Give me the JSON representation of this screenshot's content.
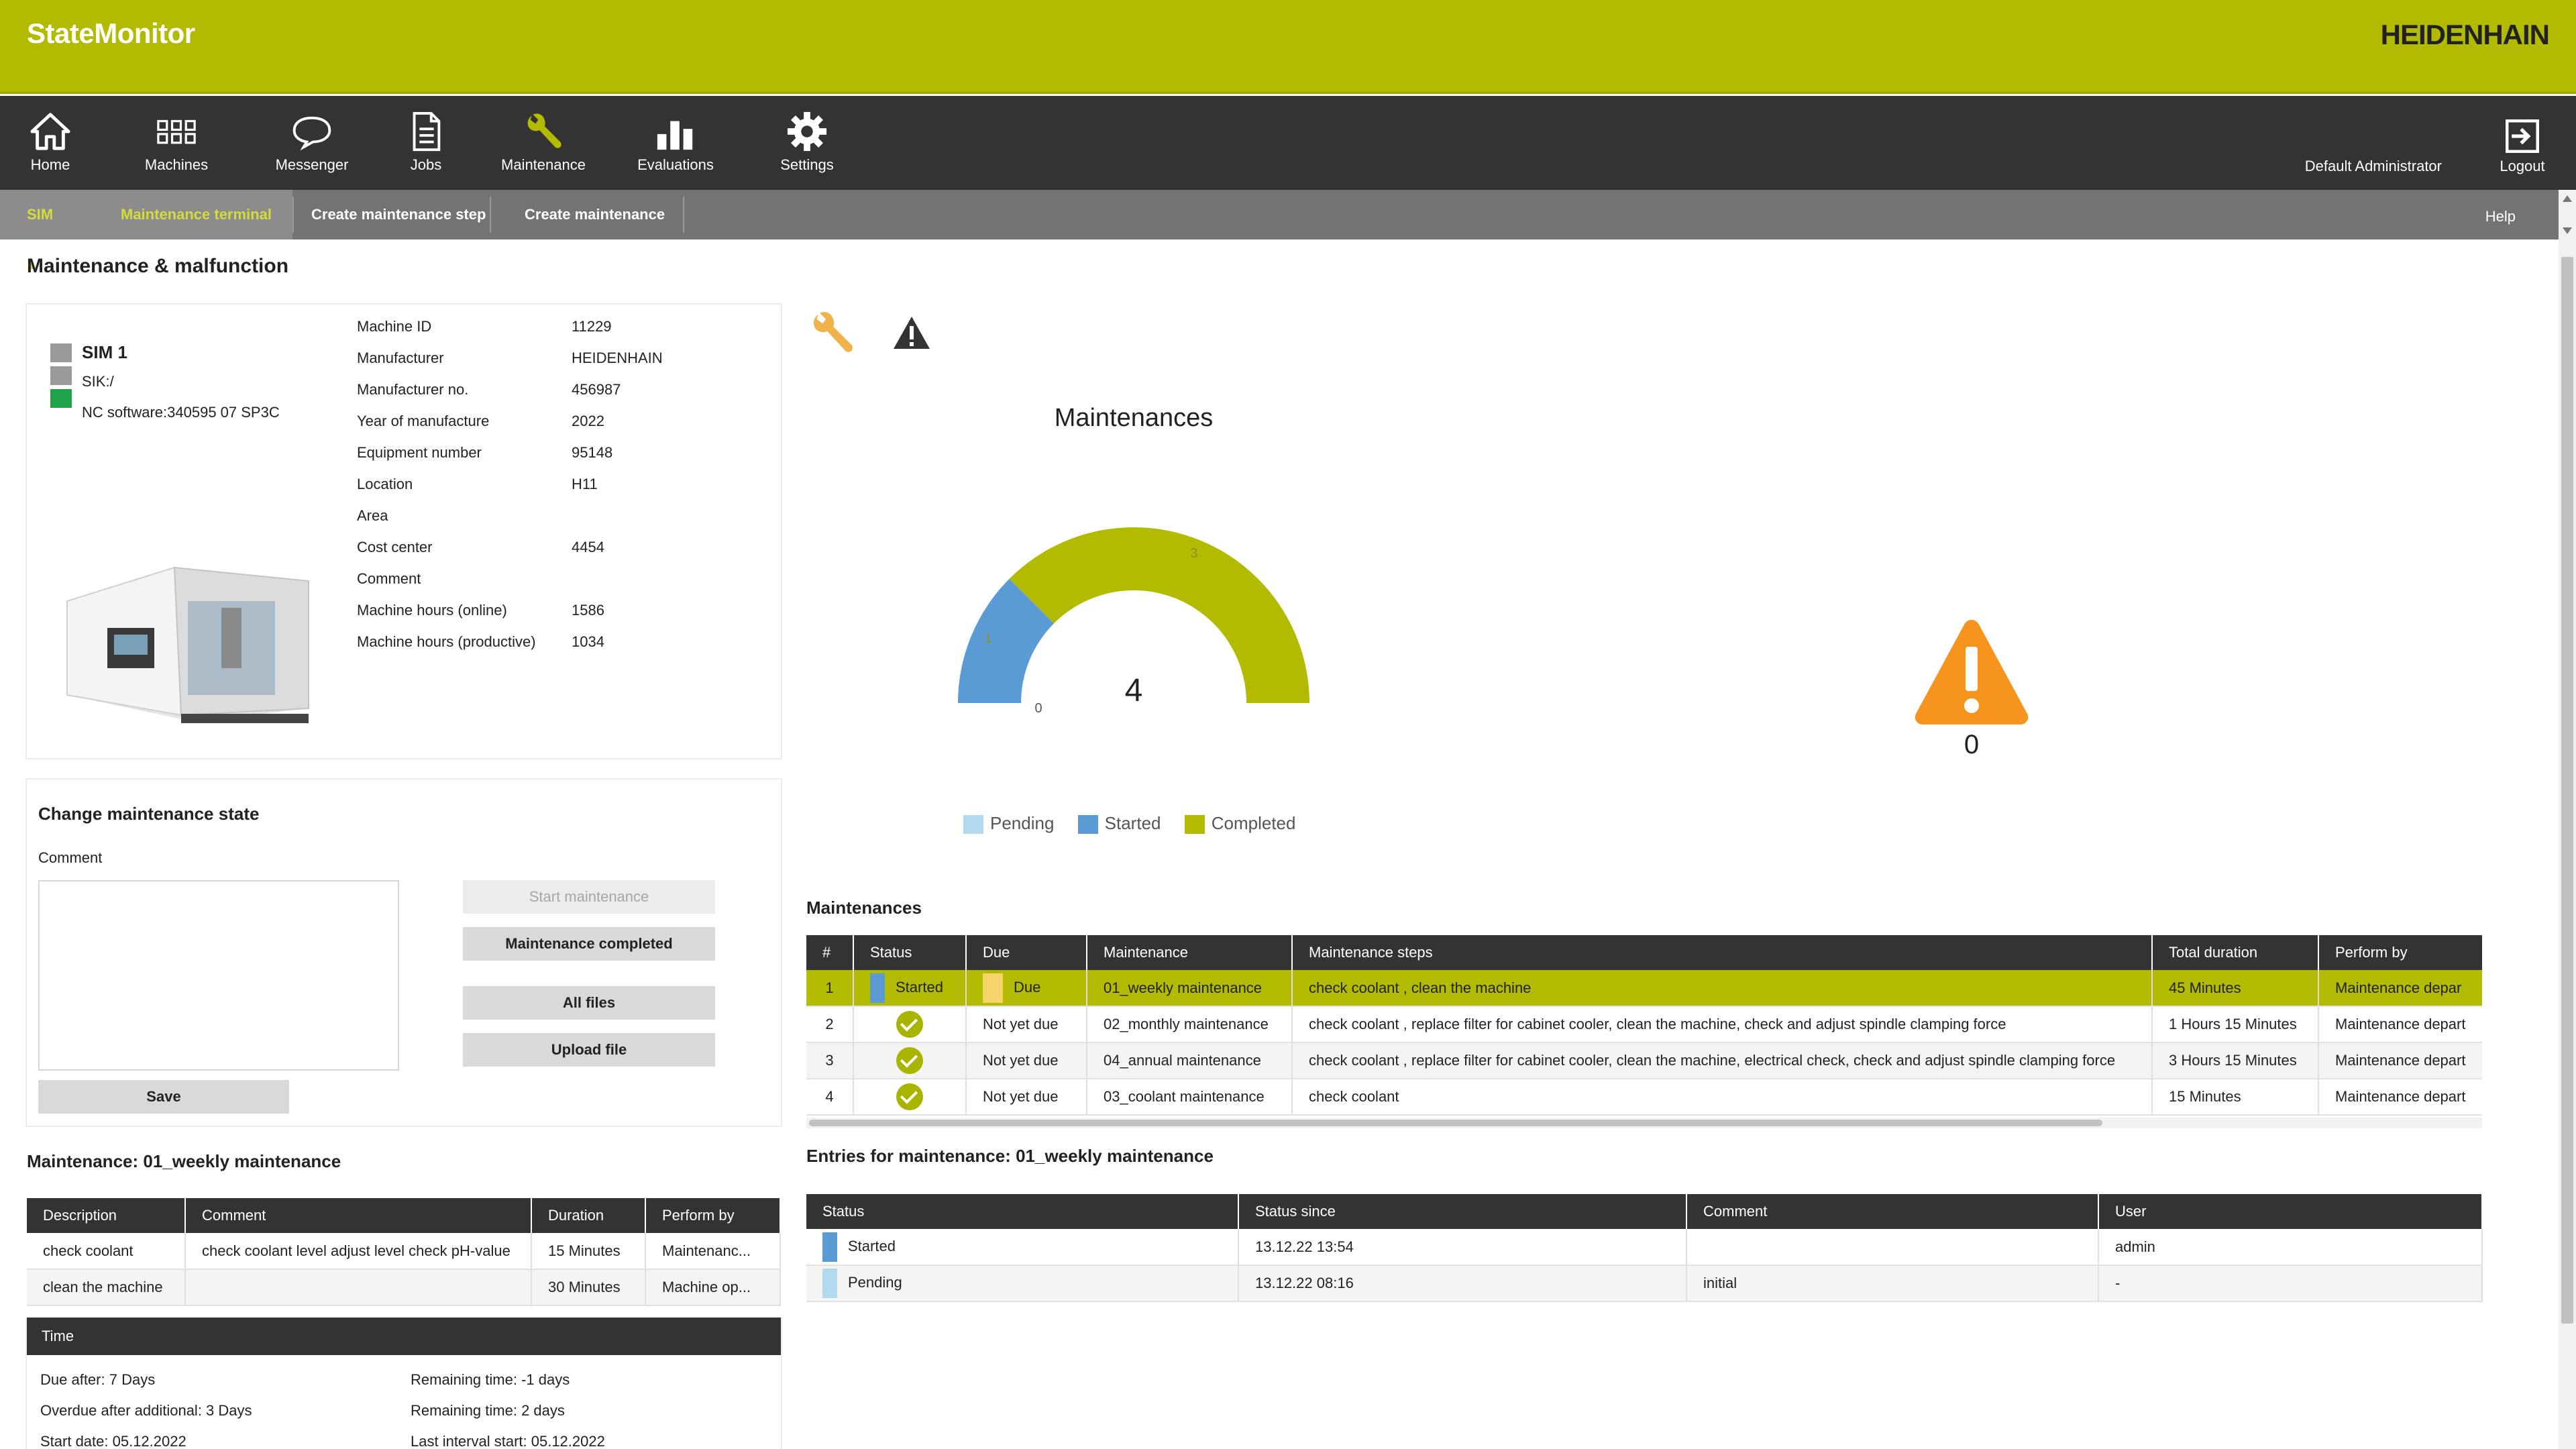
{
  "header": {
    "app_title": "StateMonitor",
    "brand": "HEIDENHAIN",
    "accent_color": "#b2bb00"
  },
  "nav": {
    "items": [
      {
        "label": "Home",
        "icon": "home-icon"
      },
      {
        "label": "Machines",
        "icon": "machines-grid-icon"
      },
      {
        "label": "Messenger",
        "icon": "speech-bubble-icon"
      },
      {
        "label": "Jobs",
        "icon": "document-icon"
      },
      {
        "label": "Maintenance",
        "icon": "wrench-icon"
      },
      {
        "label": "Evaluations",
        "icon": "bar-chart-icon"
      },
      {
        "label": "Settings",
        "icon": "gear-icon"
      }
    ],
    "user": "Default Administrator",
    "logout_label": "Logout"
  },
  "subnav": {
    "machine": "SIM 1",
    "items": [
      "Maintenance terminal",
      "Create maintenance step",
      "Create maintenance"
    ],
    "help": "Help"
  },
  "page": {
    "title": "Maintenance & malfunction"
  },
  "machine": {
    "name": "SIM 1",
    "sik": "SIK:/",
    "nc_software": "NC software:340595 07 SP3C",
    "status_colors": [
      "#9a9a9a",
      "#9a9a9a",
      "#1ea24a"
    ],
    "info": [
      {
        "label": "Machine ID",
        "value": "11229"
      },
      {
        "label": "Manufacturer",
        "value": "HEIDENHAIN"
      },
      {
        "label": "Manufacturer no.",
        "value": "456987"
      },
      {
        "label": "Year of manufacture",
        "value": "2022"
      },
      {
        "label": "Equipment number",
        "value": "95148"
      },
      {
        "label": "Location",
        "value": "H11"
      },
      {
        "label": "Area",
        "value": ""
      },
      {
        "label": "Cost center",
        "value": "4454"
      },
      {
        "label": "Comment",
        "value": ""
      },
      {
        "label": "Machine hours (online)",
        "value": "1586"
      },
      {
        "label": "Machine hours (productive)",
        "value": "1034"
      }
    ]
  },
  "change_state": {
    "title": "Change maintenance state",
    "comment_label": "Comment",
    "comment_value": "",
    "start_btn": "Start maintenance",
    "completed_btn": "Maintenance completed",
    "all_files_btn": "All files",
    "upload_btn": "Upload file",
    "save_btn": "Save"
  },
  "maintenance_detail": {
    "title": "Maintenance: 01_weekly maintenance",
    "columns": [
      "Description",
      "Comment",
      "Duration",
      "Perform by"
    ],
    "rows": [
      [
        "check coolant",
        "check coolant level adjust level check pH-value",
        "15 Minutes",
        "Maintenanc..."
      ],
      [
        "clean the machine",
        "",
        "30 Minutes",
        "Machine op..."
      ]
    ]
  },
  "time": {
    "title": "Time",
    "due_after": "Due after: 7 Days",
    "remaining_1": "Remaining time: -1 days",
    "overdue": "Overdue after additional: 3 Days",
    "remaining_2": "Remaining time: 2 days",
    "start_date": "Start date: 05.12.2022",
    "last_interval": "Last interval start: 05.12.2022"
  },
  "chart_data": {
    "type": "pie",
    "title": "Maintenances",
    "total": "4",
    "scale_start": "0",
    "categories": [
      "Pending",
      "Started",
      "Completed"
    ],
    "values": [
      0,
      1,
      3
    ],
    "colors": [
      "#b3d9ef",
      "#5b9bd5",
      "#b2bb00"
    ],
    "legend": "bottom"
  },
  "malfunctions": {
    "count": "0",
    "icon": "warning-icon",
    "color": "#f7941d"
  },
  "maintenances": {
    "title": "Maintenances",
    "columns": [
      "#",
      "Status",
      "Due",
      "Maintenance",
      "Maintenance steps",
      "Total duration",
      "Perform by"
    ],
    "rows": [
      {
        "num": "1",
        "status": "Started",
        "status_color": "#5b9bd5",
        "due": "Due",
        "due_color": "#f8d46c",
        "name": "01_weekly maintenance",
        "steps": "check coolant , clean the machine",
        "duration": "45 Minutes",
        "perform": "Maintenance depar"
      },
      {
        "num": "2",
        "status": "completed",
        "due": "Not yet due",
        "name": "02_monthly maintenance",
        "steps": "check coolant , replace filter for cabinet cooler, clean the machine, check and adjust spindle clamping force",
        "duration": "1 Hours 15 Minutes",
        "perform": "Maintenance depart"
      },
      {
        "num": "3",
        "status": "completed",
        "due": "Not yet due",
        "name": "04_annual maintenance",
        "steps": "check coolant , replace filter for cabinet cooler, clean the machine, electrical check, check and adjust spindle clamping force",
        "duration": "3 Hours 15 Minutes",
        "perform": "Maintenance depart"
      },
      {
        "num": "4",
        "status": "completed",
        "due": "Not yet due",
        "name": "03_coolant maintenance",
        "steps": "check coolant",
        "duration": "15 Minutes",
        "perform": "Maintenance depart"
      }
    ]
  },
  "entries": {
    "title": "Entries for maintenance: 01_weekly maintenance",
    "columns": [
      "Status",
      "Status since",
      "Comment",
      "User"
    ],
    "rows": [
      {
        "status": "Started",
        "color": "#5b9bd5",
        "since": "13.12.22 13:54",
        "comment": "",
        "user": "admin"
      },
      {
        "status": "Pending",
        "color": "#b3d9ef",
        "since": "13.12.22 08:16",
        "comment": "initial",
        "user": "-"
      }
    ]
  }
}
